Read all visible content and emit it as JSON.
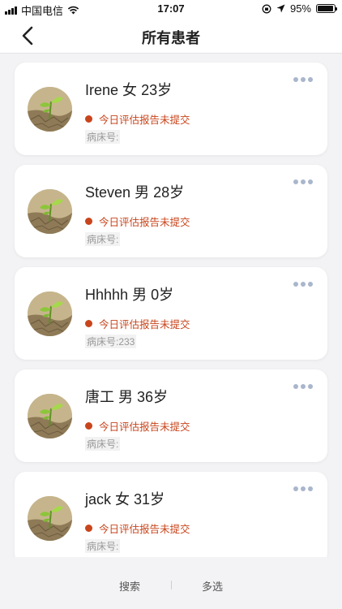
{
  "status_bar": {
    "carrier": "中国电信",
    "time": "17:07",
    "battery_percent": "95%",
    "battery_level": 0.95
  },
  "nav": {
    "title": "所有患者",
    "back_icon": "chevron-left-icon"
  },
  "patients": [
    {
      "name": "Irene",
      "gender": "女",
      "age": "23岁",
      "status": "今日评估报告未提交",
      "bed": "病床号:"
    },
    {
      "name": "Steven",
      "gender": "男",
      "age": "28岁",
      "status": "今日评估报告未提交",
      "bed": "病床号:"
    },
    {
      "name": "Hhhhh",
      "gender": "男",
      "age": "0岁",
      "status": "今日评估报告未提交",
      "bed": "病床号:233"
    },
    {
      "name": "唐工",
      "gender": "男",
      "age": "36岁",
      "status": "今日评估报告未提交",
      "bed": "病床号:"
    },
    {
      "name": "jack",
      "gender": "女",
      "age": "31岁",
      "status": "今日评估报告未提交",
      "bed": "病床号:"
    }
  ],
  "bottom_bar": {
    "search_label": "搜索",
    "multi_select_label": "多选"
  },
  "colors": {
    "status_red": "#c8451c",
    "more_dots": "#a9b6cc",
    "background": "#f3f3f5"
  }
}
